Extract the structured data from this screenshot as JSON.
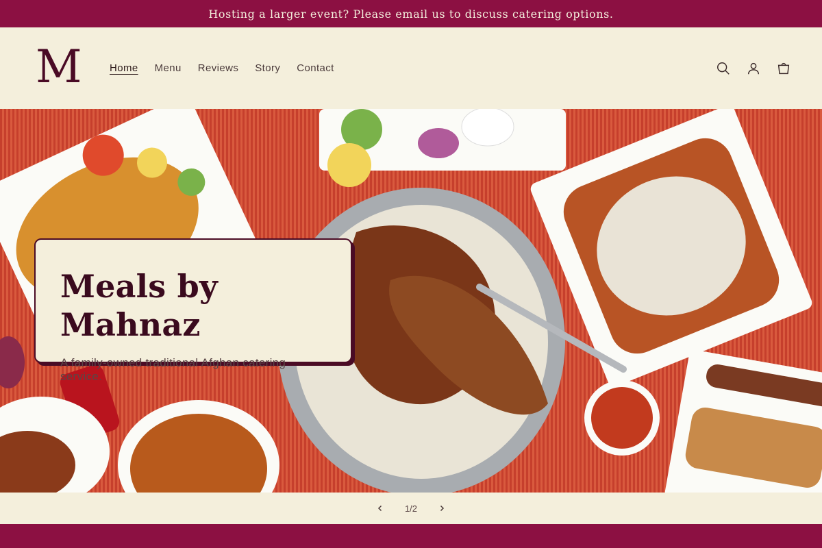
{
  "announcement": {
    "text": "Hosting a larger event? Please email us to discuss catering options."
  },
  "logo": {
    "text": "M"
  },
  "nav": {
    "items": [
      {
        "label": "Home",
        "active": true
      },
      {
        "label": "Menu"
      },
      {
        "label": "Reviews"
      },
      {
        "label": "Story"
      },
      {
        "label": "Contact"
      }
    ]
  },
  "icons": {
    "search": "search-icon",
    "account": "account-icon",
    "cart": "cart-icon"
  },
  "hero": {
    "title": "Meals by Mahnaz",
    "subtitle": "A family-owned traditional Afghan catering service."
  },
  "slider": {
    "counter": "1/2"
  },
  "colors": {
    "brand": "#8c1042",
    "cream": "#f4efdc",
    "dark_wine": "#4a0b25"
  }
}
